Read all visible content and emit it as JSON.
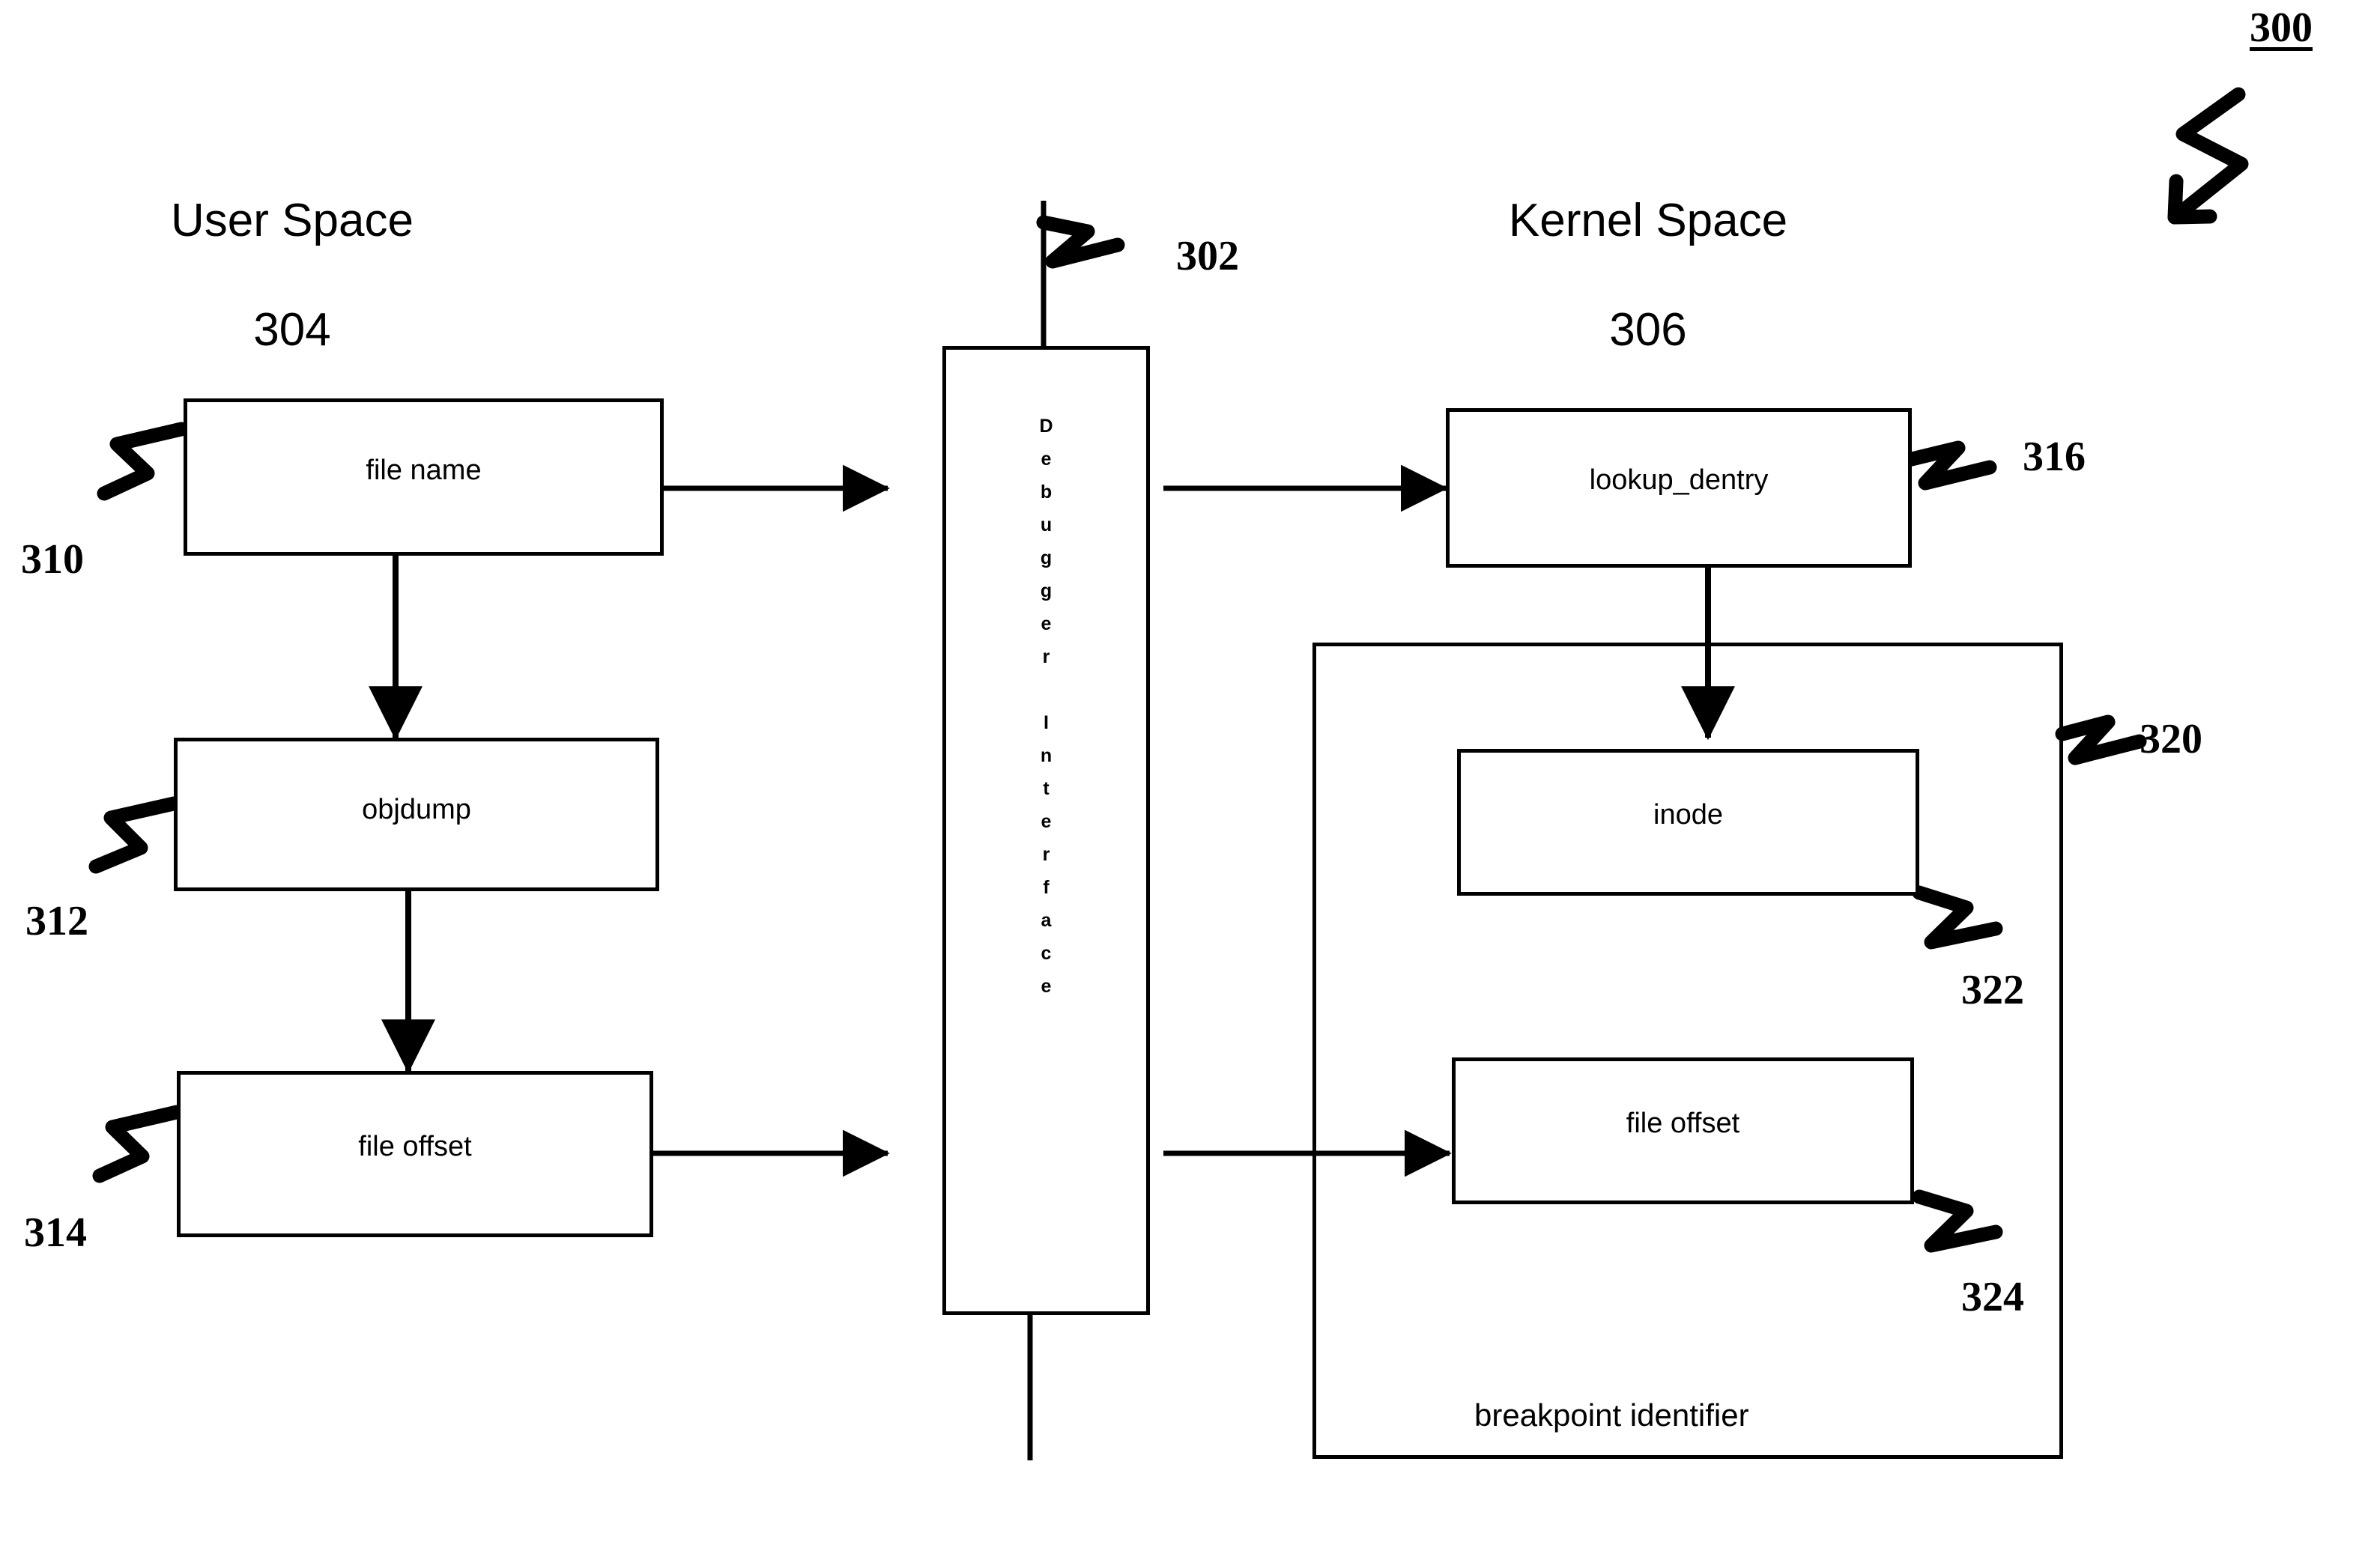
{
  "figure": {
    "figure_number": "300",
    "sections": [
      {
        "title": "User Space",
        "number": "304"
      },
      {
        "title": "Kernel Space",
        "number": "306"
      }
    ],
    "interface_bar": {
      "label": "Debugger Interface",
      "letters": [
        "D",
        "e",
        "b",
        "u",
        "g",
        "g",
        "e",
        "r",
        "",
        "I",
        "n",
        "t",
        "e",
        "r",
        "f",
        "a",
        "c",
        "e"
      ],
      "ref": "302"
    },
    "user_space_boxes": [
      {
        "label": "file name",
        "ref": "310"
      },
      {
        "label": "objdump",
        "ref": "312"
      },
      {
        "label": "file offset",
        "ref": "314"
      }
    ],
    "kernel_space_boxes": [
      {
        "label": "lookup_dentry",
        "ref": "316"
      },
      {
        "label": "inode",
        "ref": "322"
      },
      {
        "label": "file offset",
        "ref": "324"
      }
    ],
    "group": {
      "caption": "breakpoint identifier",
      "ref": "320"
    },
    "colors": {
      "ink": "#000000",
      "paper": "#ffffff"
    }
  }
}
